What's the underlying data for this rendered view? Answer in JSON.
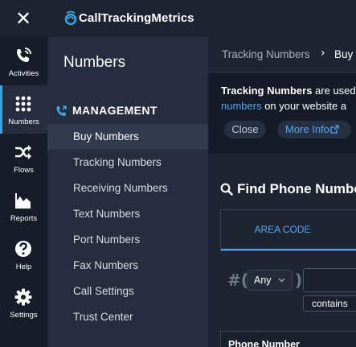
{
  "app": {
    "brand_name": "CallTrackingMetrics",
    "accent_color": "#3ea3dc",
    "link_color": "#55a8f0"
  },
  "rail": {
    "items": [
      {
        "label": "Activities",
        "icon": "phone-signal-icon",
        "active": false
      },
      {
        "label": "Numbers",
        "icon": "keypad-icon",
        "active": true
      },
      {
        "label": "Flows",
        "icon": "shuffle-icon",
        "active": false
      },
      {
        "label": "Reports",
        "icon": "area-chart-icon",
        "active": false
      },
      {
        "label": "Help",
        "icon": "question-icon",
        "active": false
      },
      {
        "label": "Settings",
        "icon": "gear-icon",
        "active": false
      }
    ]
  },
  "subnav": {
    "title": "Numbers",
    "section_label": "MANAGEMENT",
    "section_icon": "phone-forward-icon",
    "items": [
      {
        "label": "Buy Numbers",
        "selected": true
      },
      {
        "label": "Tracking Numbers",
        "selected": false
      },
      {
        "label": "Receiving Numbers",
        "selected": false
      },
      {
        "label": "Text Numbers",
        "selected": false
      },
      {
        "label": "Port Numbers",
        "selected": false
      },
      {
        "label": "Fax Numbers",
        "selected": false
      },
      {
        "label": "Call Settings",
        "selected": false
      },
      {
        "label": "Trust Center",
        "selected": false
      }
    ]
  },
  "breadcrumb": {
    "parent": "Tracking Numbers",
    "separator": "›",
    "current": "Buy"
  },
  "info": {
    "bold_text": "Tracking Numbers",
    "text_after_bold": " are used",
    "link_text": "numbers",
    "text_after_link": " on your website a",
    "close_label": "Close",
    "more_label": "More Info"
  },
  "find": {
    "title": "Find Phone Numbe",
    "tab_label": "AREA CODE",
    "hash_paren": "#(",
    "close_paren": ")",
    "any_value": "Any",
    "contains_value": "contains",
    "column_header": "Phone Number"
  }
}
